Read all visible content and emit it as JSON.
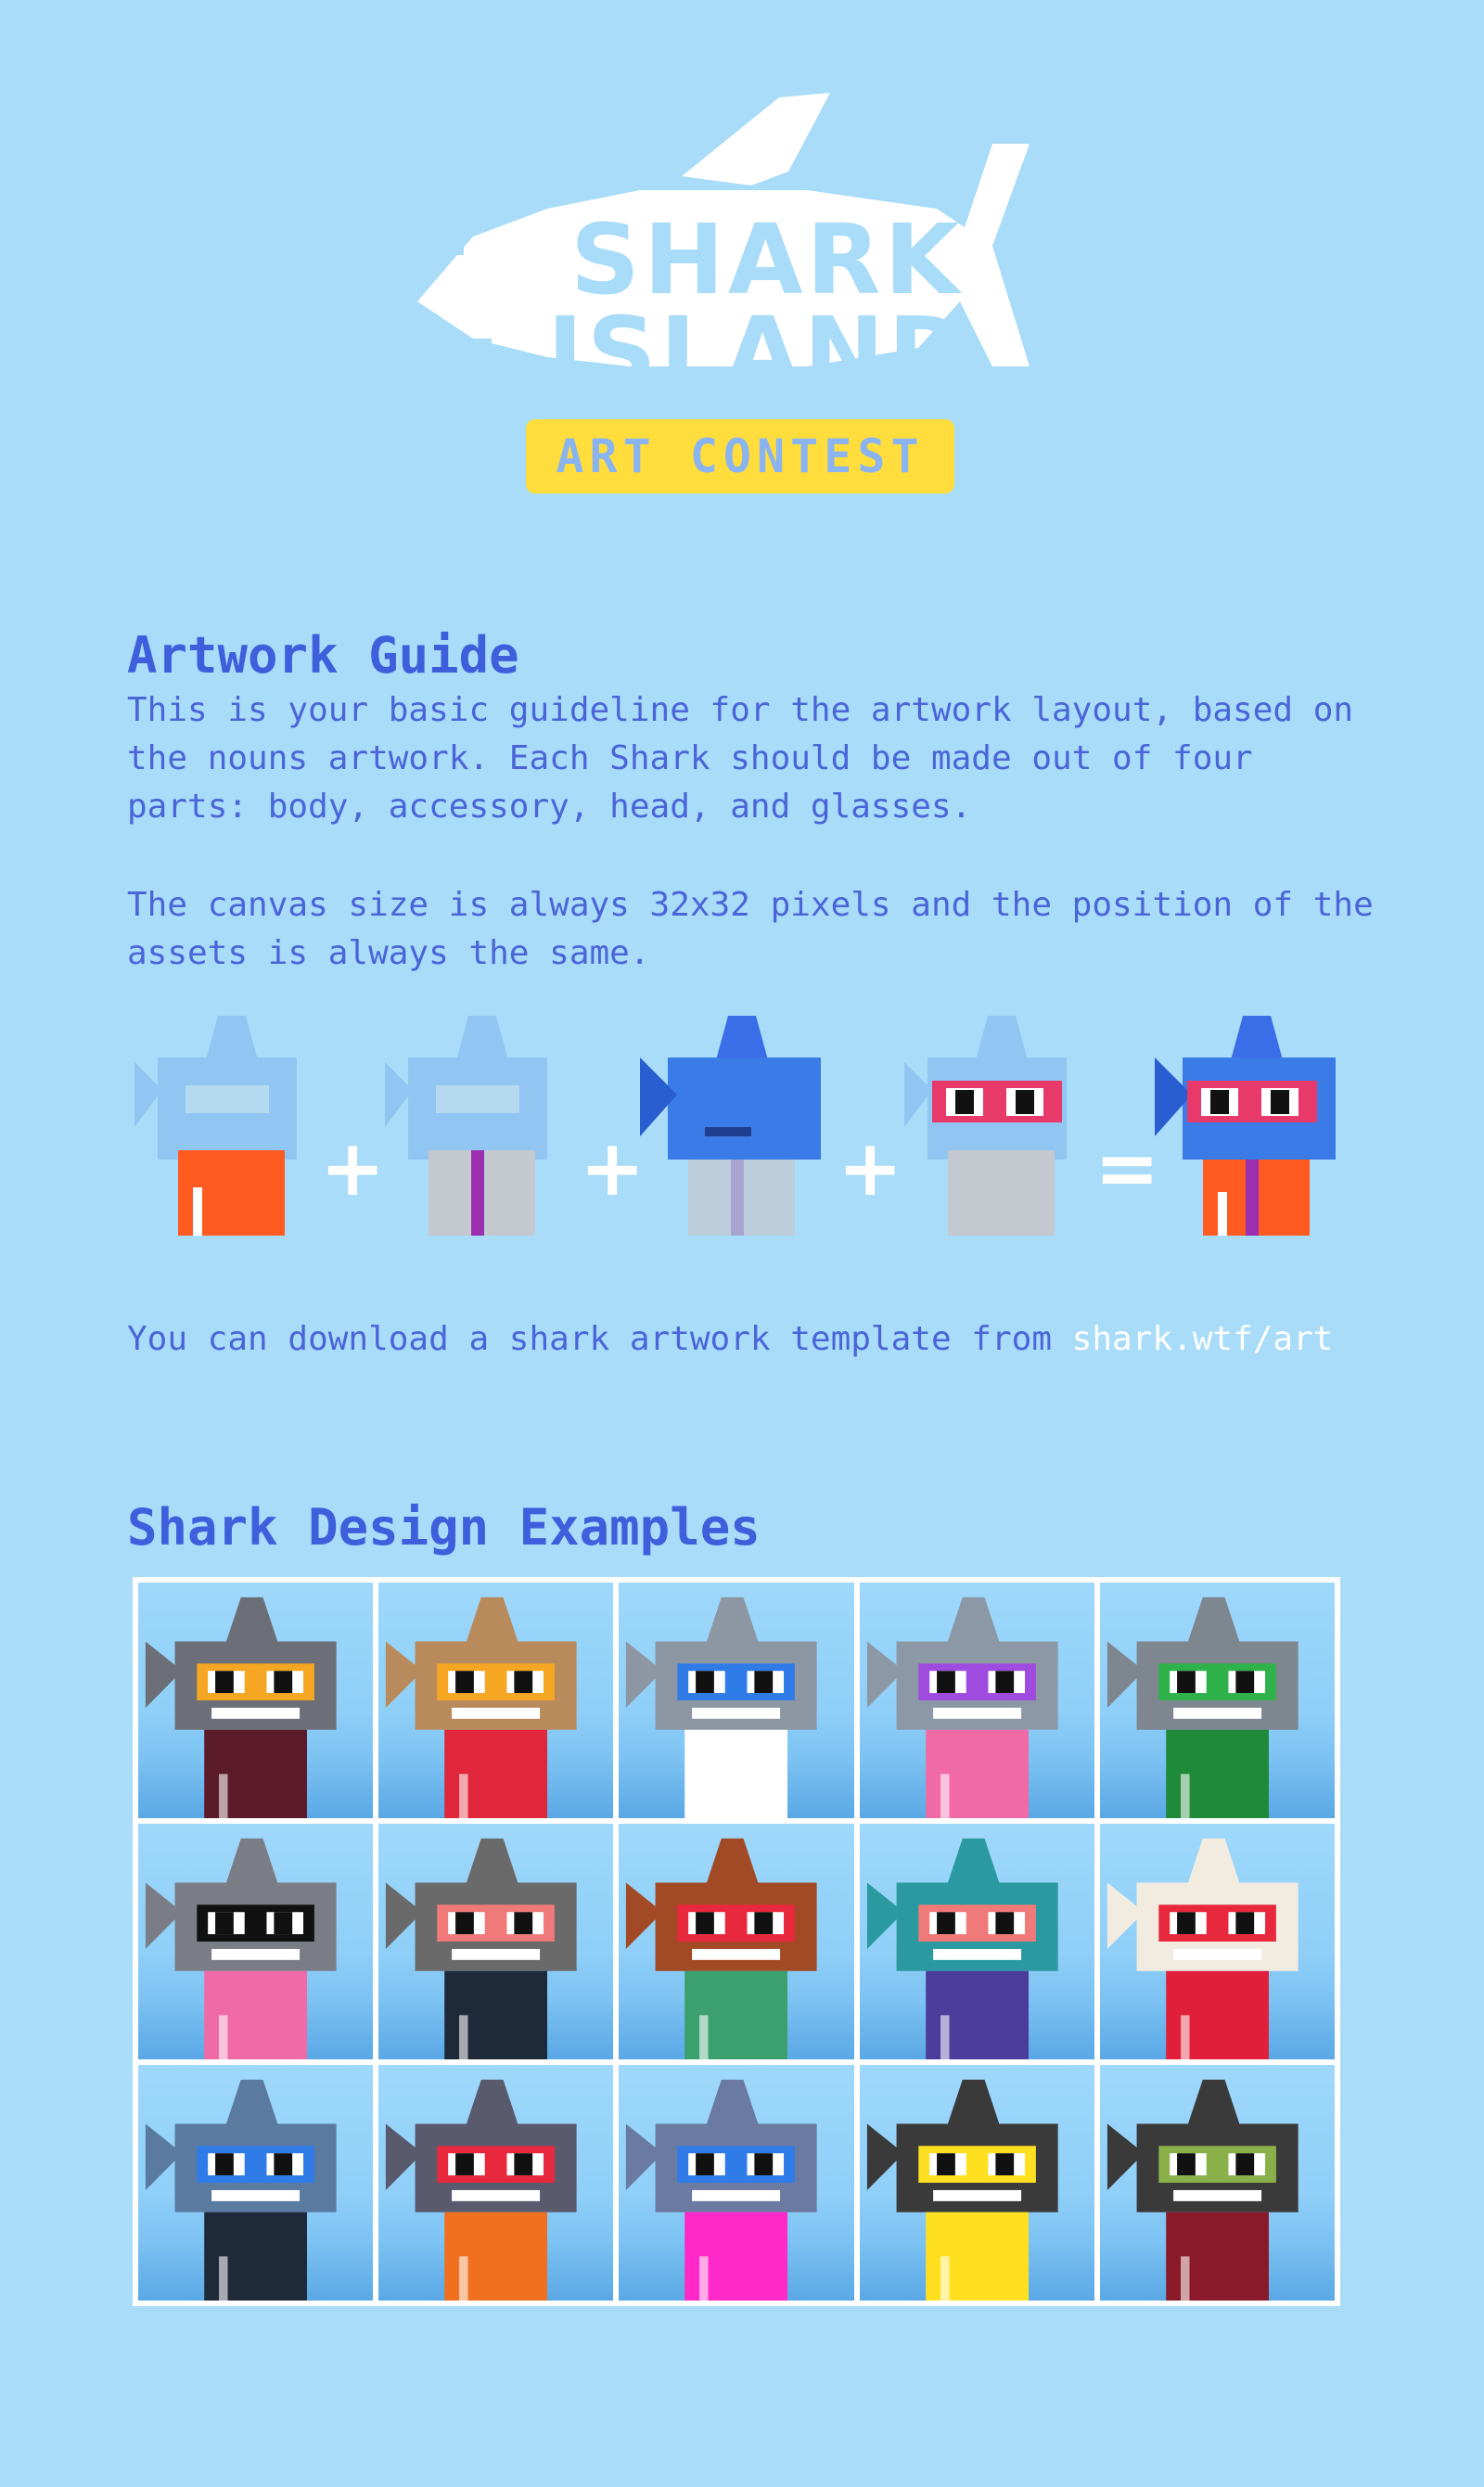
{
  "hero": {
    "title_line1": "SHARK",
    "title_line2": "ISLAND",
    "subtitle": "ART CONTEST"
  },
  "guide": {
    "heading": "Artwork Guide",
    "para1": "This is your basic guideline for the artwork layout, based on the nouns artwork. Each Shark should be made out of four parts: body, accessory, head, and glasses.",
    "para2": "The canvas size is always 32x32 pixels and the position of the assets is always the same.",
    "download_text": "You can download a shark artwork template from ",
    "download_link": "shark.wtf/art"
  },
  "formula": {
    "operators": [
      "+",
      "+",
      "+",
      "="
    ]
  },
  "examples": {
    "heading": "Shark Design Examples",
    "cells": [
      {
        "head": "#6c6f78",
        "glasses": "#f5a623",
        "body": "#5b1b2a"
      },
      {
        "head": "#b98a5c",
        "glasses": "#f5a623",
        "body": "#e0263a"
      },
      {
        "head": "#8d96a3",
        "glasses": "#2f7be8",
        "body": "#ffffff"
      },
      {
        "head": "#8d98a6",
        "glasses": "#a04be0",
        "body": "#f06aa6"
      },
      {
        "head": "#7e8690",
        "glasses": "#2fb24a",
        "body": "#1f8a3a"
      },
      {
        "head": "#7a7d85",
        "glasses": "#111111",
        "body": "#f06aa6"
      },
      {
        "head": "#6a6a6a",
        "glasses": "#f07a7a",
        "body": "#1e2a3a"
      },
      {
        "head": "#a24a26",
        "glasses": "#e8283c",
        "body": "#3ca06e"
      },
      {
        "head": "#2a9aa0",
        "glasses": "#f07a7a",
        "body": "#4b3b9a"
      },
      {
        "head": "#f2ece0",
        "glasses": "#e8283c",
        "body": "#e0203a"
      },
      {
        "head": "#5a7aa0",
        "glasses": "#2f7be8",
        "body": "#1e2a3a"
      },
      {
        "head": "#5a5a6e",
        "glasses": "#e8283c",
        "body": "#f07020"
      },
      {
        "head": "#6a7aa0",
        "glasses": "#2f7be8",
        "body": "#ff28c8"
      },
      {
        "head": "#3a3a3a",
        "glasses": "#ffe020",
        "body": "#ffe020"
      },
      {
        "head": "#3a3a3a",
        "glasses": "#8ab04a",
        "body": "#8a1a2a"
      }
    ]
  }
}
